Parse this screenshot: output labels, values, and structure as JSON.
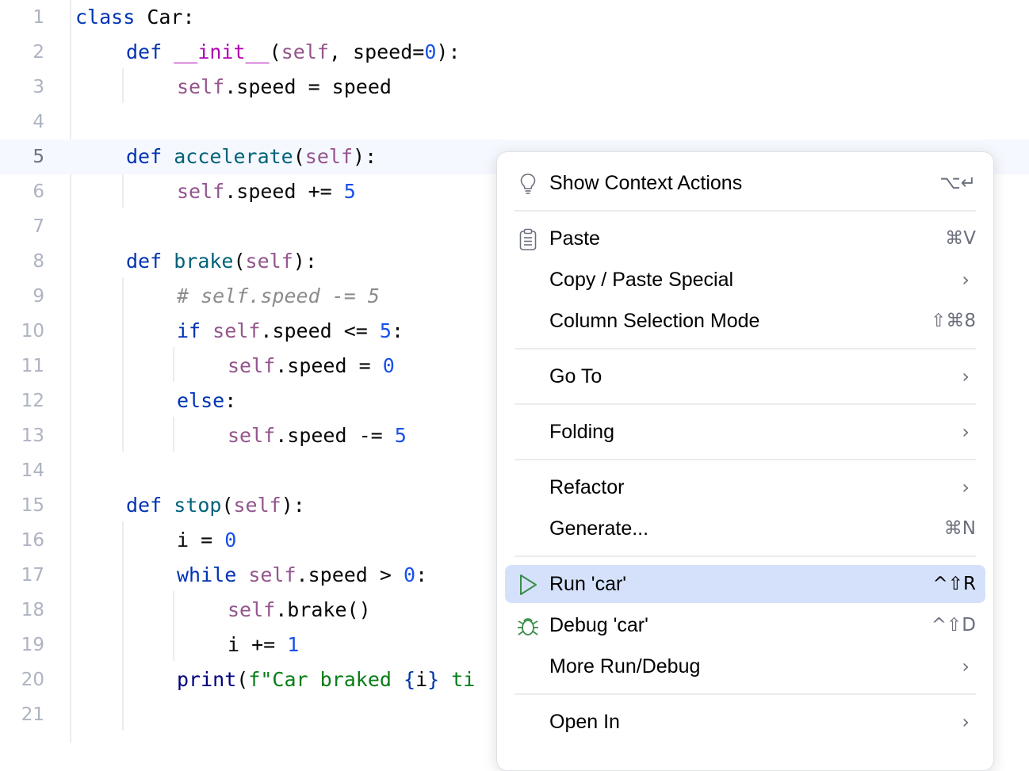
{
  "editor": {
    "current_line": 5,
    "lines": [
      {
        "n": "1",
        "tokens": [
          [
            "kw",
            "class"
          ],
          [
            "",
            "&nbsp;Car:"
          ]
        ]
      },
      {
        "n": "2"
      },
      {
        "n": "3"
      },
      {
        "n": "4"
      },
      {
        "n": "5"
      },
      {
        "n": "6"
      },
      {
        "n": "7"
      },
      {
        "n": "8"
      },
      {
        "n": "9"
      },
      {
        "n": "10"
      },
      {
        "n": "11"
      },
      {
        "n": "12"
      },
      {
        "n": "13"
      },
      {
        "n": "14"
      },
      {
        "n": "15"
      },
      {
        "n": "16"
      },
      {
        "n": "17"
      },
      {
        "n": "18"
      },
      {
        "n": "19"
      },
      {
        "n": "20"
      },
      {
        "n": "21"
      }
    ],
    "code": {
      "l1": {
        "kw": "class",
        "rest": " Car:"
      },
      "l2": {
        "kw": "def",
        "name": "__init__",
        "open": "(",
        "self": "self",
        "rest": ", speed=",
        "num": "0",
        "close": "):"
      },
      "l3": {
        "self": "self",
        "rest": ".speed = speed"
      },
      "l5": {
        "kw": "def",
        "name": "accelerate",
        "open": "(",
        "self": "self",
        "close": "):"
      },
      "l6": {
        "self": "self",
        "rest": ".speed += ",
        "num": "5"
      },
      "l8": {
        "kw": "def",
        "name": "brake",
        "open": "(",
        "self": "self",
        "close": "):"
      },
      "l9": {
        "comment": "# self.speed -= 5"
      },
      "l10": {
        "kw": "if",
        "self": "self",
        "rest": ".speed <= ",
        "num": "5",
        "close": ":"
      },
      "l11": {
        "self": "self",
        "rest": ".speed = ",
        "num": "0"
      },
      "l12": {
        "kw": "else",
        "close": ":"
      },
      "l13": {
        "self": "self",
        "rest": ".speed -= ",
        "num": "5"
      },
      "l15": {
        "kw": "def",
        "name": "stop",
        "open": "(",
        "self": "self",
        "close": "):"
      },
      "l16": {
        "rest": "i = ",
        "num": "0"
      },
      "l17": {
        "kw": "while",
        "self": "self",
        "rest": ".speed > ",
        "num": "0",
        "close": ":"
      },
      "l18": {
        "self": "self",
        "rest": ".brake()"
      },
      "l19": {
        "rest": "i += ",
        "num": "1"
      },
      "l20": {
        "builtin": "print",
        "open": "(",
        "str1": "f\"Car braked ",
        "brace_open": "{",
        "var": "i",
        "brace_close": "}",
        "str2": " ti"
      }
    }
  },
  "context_menu": {
    "items": [
      {
        "label": "Show Context Actions",
        "icon": "lightbulb-icon",
        "shortcut": "⌥↵"
      },
      {
        "label": "Paste",
        "icon": "clipboard-icon",
        "shortcut": "⌘V"
      },
      {
        "label": "Copy / Paste Special",
        "submenu": true
      },
      {
        "label": "Column Selection Mode",
        "shortcut": "⇧⌘8"
      },
      {
        "label": "Go To",
        "submenu": true
      },
      {
        "label": "Folding",
        "submenu": true
      },
      {
        "label": "Refactor",
        "submenu": true
      },
      {
        "label": "Generate...",
        "shortcut": "⌘N"
      },
      {
        "label": "Run 'car'",
        "icon": "run-icon",
        "shortcut": "^⇧R",
        "selected": true
      },
      {
        "label": "Debug 'car'",
        "icon": "debug-icon",
        "shortcut": "^⇧D"
      },
      {
        "label": "More Run/Debug",
        "submenu": true
      },
      {
        "label": "Open In",
        "submenu": true
      }
    ],
    "chevron": "›"
  },
  "colors": {
    "selected_bg": "#d5e1fb",
    "run_green": "#3b8d4a",
    "keyword": "#0033b3",
    "self": "#94558d",
    "function": "#00627a",
    "number": "#1750eb",
    "string": "#067d17"
  }
}
